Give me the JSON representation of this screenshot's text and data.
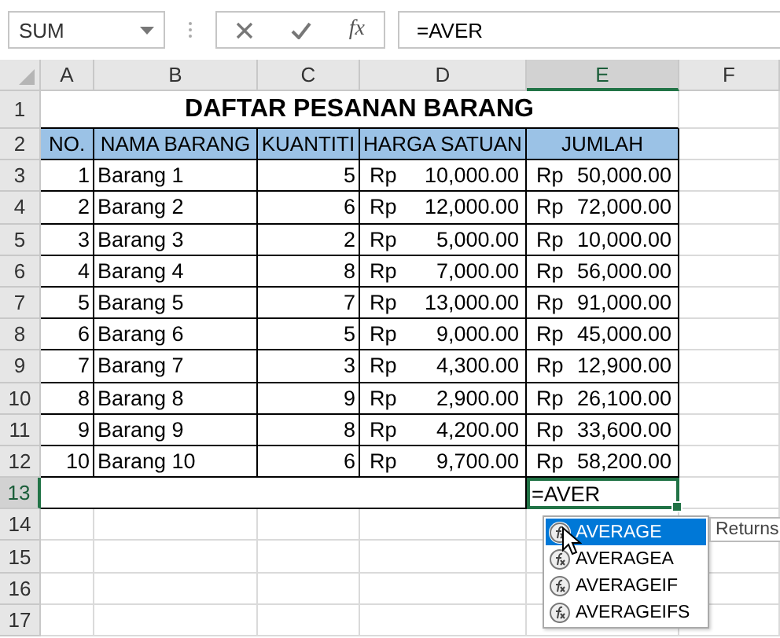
{
  "name_box": {
    "value": "SUM"
  },
  "formula_bar": {
    "fx_label": "fx",
    "value": "=AVER"
  },
  "columns": [
    {
      "label": "A",
      "selected": false
    },
    {
      "label": "B",
      "selected": false
    },
    {
      "label": "C",
      "selected": false
    },
    {
      "label": "D",
      "selected": false
    },
    {
      "label": "E",
      "selected": true
    },
    {
      "label": "F",
      "selected": false
    }
  ],
  "title": "DAFTAR PESANAN BARANG",
  "headers": [
    "NO.",
    "NAMA BARANG",
    "KUANTITI",
    "HARGA SATUAN",
    "JUMLAH"
  ],
  "rows": [
    {
      "no": "1",
      "name": "Barang 1",
      "qty": "5",
      "price_currency": "Rp",
      "price": "10,000.00",
      "total_currency": "Rp",
      "total": "50,000.00"
    },
    {
      "no": "2",
      "name": "Barang 2",
      "qty": "6",
      "price_currency": "Rp",
      "price": "12,000.00",
      "total_currency": "Rp",
      "total": "72,000.00"
    },
    {
      "no": "3",
      "name": "Barang 3",
      "qty": "2",
      "price_currency": "Rp",
      "price": "5,000.00",
      "total_currency": "Rp",
      "total": "10,000.00"
    },
    {
      "no": "4",
      "name": "Barang 4",
      "qty": "8",
      "price_currency": "Rp",
      "price": "7,000.00",
      "total_currency": "Rp",
      "total": "56,000.00"
    },
    {
      "no": "5",
      "name": "Barang 5",
      "qty": "7",
      "price_currency": "Rp",
      "price": "13,000.00",
      "total_currency": "Rp",
      "total": "91,000.00"
    },
    {
      "no": "6",
      "name": "Barang 6",
      "qty": "5",
      "price_currency": "Rp",
      "price": "9,000.00",
      "total_currency": "Rp",
      "total": "45,000.00"
    },
    {
      "no": "7",
      "name": "Barang 7",
      "qty": "3",
      "price_currency": "Rp",
      "price": "4,300.00",
      "total_currency": "Rp",
      "total": "12,900.00"
    },
    {
      "no": "8",
      "name": "Barang 8",
      "qty": "9",
      "price_currency": "Rp",
      "price": "2,900.00",
      "total_currency": "Rp",
      "total": "26,100.00"
    },
    {
      "no": "9",
      "name": "Barang 9",
      "qty": "8",
      "price_currency": "Rp",
      "price": "4,200.00",
      "total_currency": "Rp",
      "total": "33,600.00"
    },
    {
      "no": "10",
      "name": "Barang 10",
      "qty": "6",
      "price_currency": "Rp",
      "price": "9,700.00",
      "total_currency": "Rp",
      "total": "58,200.00"
    }
  ],
  "row_numbers": [
    {
      "label": "1",
      "selected": false
    },
    {
      "label": "2",
      "selected": false
    },
    {
      "label": "3",
      "selected": false
    },
    {
      "label": "4",
      "selected": false
    },
    {
      "label": "5",
      "selected": false
    },
    {
      "label": "6",
      "selected": false
    },
    {
      "label": "7",
      "selected": false
    },
    {
      "label": "8",
      "selected": false
    },
    {
      "label": "9",
      "selected": false
    },
    {
      "label": "10",
      "selected": false
    },
    {
      "label": "11",
      "selected": false
    },
    {
      "label": "12",
      "selected": false
    },
    {
      "label": "13",
      "selected": true
    },
    {
      "label": "14",
      "selected": false
    },
    {
      "label": "15",
      "selected": false
    },
    {
      "label": "16",
      "selected": false
    },
    {
      "label": "17",
      "selected": false
    }
  ],
  "active_cell": {
    "value": "=AVER"
  },
  "autocomplete": [
    {
      "label": "AVERAGE",
      "selected": true
    },
    {
      "label": "AVERAGEA",
      "selected": false
    },
    {
      "label": "AVERAGEIF",
      "selected": false
    },
    {
      "label": "AVERAGEIFS",
      "selected": false
    }
  ],
  "tooltip": "Returns"
}
